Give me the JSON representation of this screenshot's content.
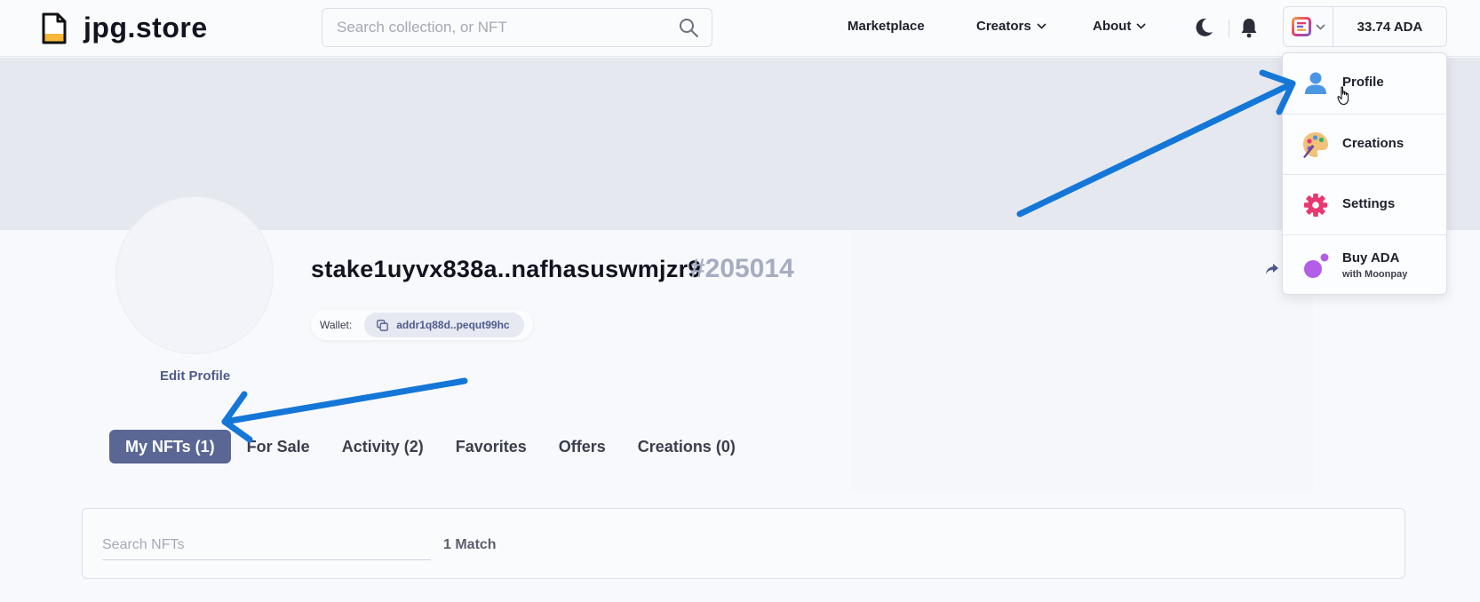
{
  "header": {
    "logo_text": "jpg.store",
    "search_placeholder": "Search collection, or NFT",
    "nav": {
      "marketplace": "Marketplace",
      "creators": "Creators",
      "about": "About"
    },
    "balance": "33.74 ADA"
  },
  "profile": {
    "name": "stake1uyvx838a..nafhasuswmjzr9",
    "number": "#205014",
    "wallet_label": "Wallet:",
    "wallet_address": "addr1q88d..pequt99hc",
    "edit_label": "Edit Profile"
  },
  "tabs": [
    {
      "label": "My NFTs (1)",
      "active": true
    },
    {
      "label": "For Sale",
      "active": false
    },
    {
      "label": "Activity (2)",
      "active": false
    },
    {
      "label": "Favorites",
      "active": false
    },
    {
      "label": "Offers",
      "active": false
    },
    {
      "label": "Creations (0)",
      "active": false
    }
  ],
  "nft_search": {
    "placeholder": "Search NFTs",
    "match_count": "1 Match"
  },
  "dropdown": {
    "items": [
      {
        "label": "Profile",
        "icon": "user-icon"
      },
      {
        "label": "Creations",
        "icon": "palette-icon"
      },
      {
        "label": "Settings",
        "icon": "gear-icon"
      },
      {
        "label": "Buy ADA",
        "sublabel": "with Moonpay",
        "icon": "moonpay-icon"
      }
    ]
  },
  "colors": {
    "accent": "#5a6694",
    "annotation_arrow": "#1477d8",
    "settings_icon": "#e8386f",
    "moonpay_icon": "#b25ee8",
    "profile_icon": "#4a96e4"
  }
}
